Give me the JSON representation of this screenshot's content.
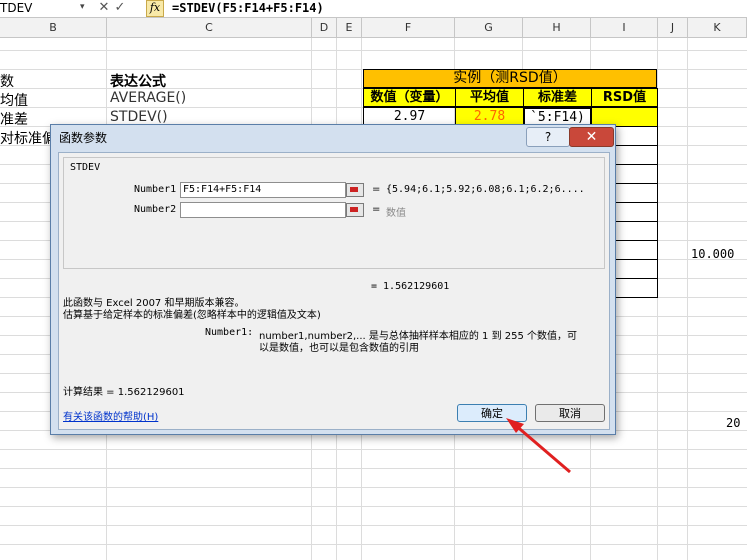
{
  "formula_bar": {
    "name_box": "TDEV",
    "dropdown_glyph": "▾",
    "cancel_glyph": "✕",
    "enter_glyph": "✓",
    "fx_label": "fx",
    "formula": "=STDEV(F5:F14+F5:F14)"
  },
  "columns": [
    "B",
    "C",
    "D",
    "E",
    "F",
    "G",
    "H",
    "I",
    "J",
    "K"
  ],
  "sheet": {
    "b_header": "数",
    "c_header": "表达公式",
    "b_row1": "均值",
    "c_row1": "AVERAGE()",
    "b_row2": "准差",
    "c_row2": "STDEV()",
    "b_row3": "对标准偏差",
    "table_title": "实例（测RSD值）",
    "table_headers": [
      "数值（变量）",
      "平均值",
      "标准差",
      "RSD值"
    ],
    "table_row1": [
      "2.97",
      "2.78",
      "`5:F14)",
      ""
    ],
    "k_value1": "10.000",
    "k_value2": "20"
  },
  "dialog": {
    "title": "函数参数",
    "help_glyph": "?",
    "close_glyph": "✕",
    "function_name": "STDEV",
    "args": [
      {
        "label": "Number1",
        "value": "F5:F14+F5:F14",
        "result": "{5.94;6.1;5.92;6.08;6.1;6.2;6...."
      },
      {
        "label": "Number2",
        "value": "",
        "result": "数值"
      }
    ],
    "eq": "=",
    "formula_result_line": "= 1.562129601",
    "desc_line1": "此函数与 Excel 2007 和早期版本兼容。",
    "desc_line2": "估算基于给定样本的标准偏差(忽略样本中的逻辑值及文本)",
    "arg_help_label": "Number1:",
    "arg_help_line1": "number1,number2,... 是与总体抽样样本相应的 1 到 255 个数值，可",
    "arg_help_line2": "以是数值，也可以是包含数值的引用",
    "calc_result": "计算结果 = 1.562129601",
    "help_link": "有关该函数的帮助(H)",
    "ok": "确定",
    "cancel": "取消"
  },
  "colors": {
    "table_title_bg": "#ffc000",
    "table_head_bg": "#ffff00",
    "average_value": "#ff6600",
    "arrow": "#e02020"
  }
}
